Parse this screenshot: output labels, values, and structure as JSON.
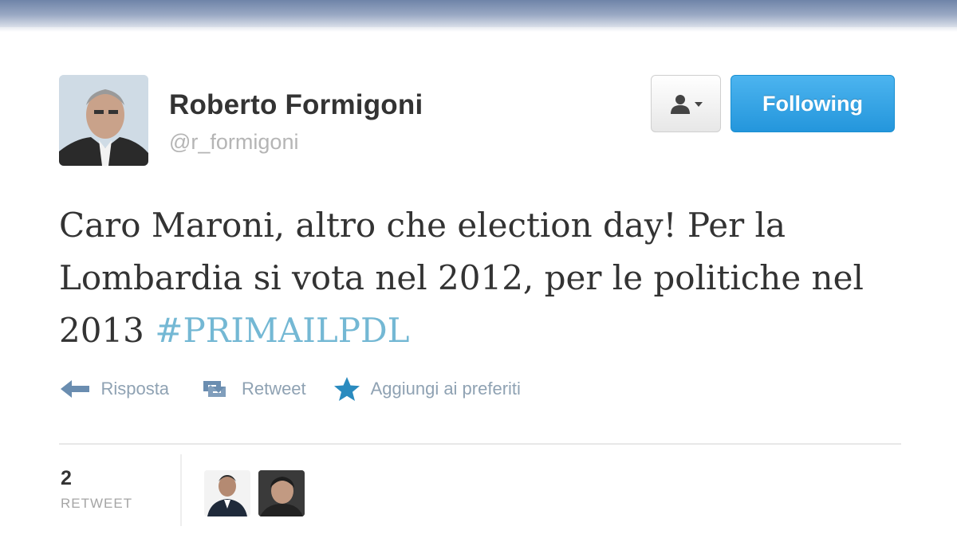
{
  "author": {
    "name": "Roberto Formigoni",
    "handle": "@r_formigoni"
  },
  "follow_button": {
    "label": "Following"
  },
  "tweet": {
    "text_before": "Caro Maroni, altro che election day! Per la Lombardia si vota nel 2012, per le politiche nel 2013 ",
    "hashtag": "#PRIMAILPDL"
  },
  "actions": {
    "reply": "Risposta",
    "retweet": "Retweet",
    "favorite": "Aggiungi ai preferiti"
  },
  "stats": {
    "retweet_count": "2",
    "retweet_label": "RETWEET"
  },
  "icons": {
    "user_menu": "user-dropdown-icon",
    "reply": "reply-arrow-icon",
    "retweet": "retweet-icon",
    "favorite": "star-icon"
  },
  "colors": {
    "follow_button": "#2aa0e6",
    "hashtag": "#74b8d4",
    "action_text": "#8fa2b3"
  }
}
